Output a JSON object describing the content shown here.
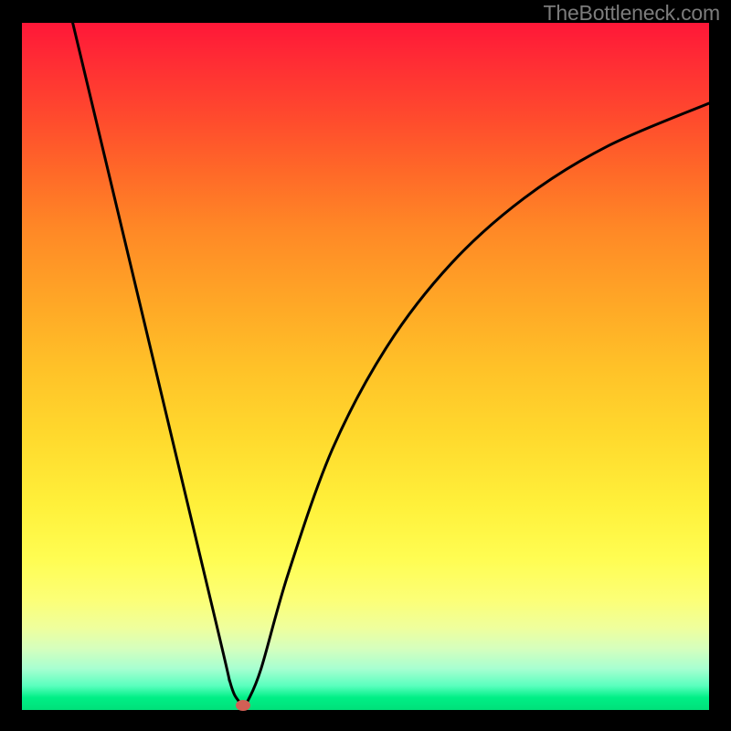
{
  "attribution": "TheBottleneck.com",
  "colors": {
    "dot": "#d16055",
    "curve": "#000000"
  },
  "chart_data": {
    "type": "line",
    "title": "",
    "xlabel": "",
    "ylabel": "",
    "xlim": [
      0,
      100
    ],
    "ylim": [
      0,
      100
    ],
    "series": [
      {
        "name": "bottleneck-curve",
        "points": [
          {
            "x": 7.4,
            "y": 100
          },
          {
            "x": 27.7,
            "y": 15
          },
          {
            "x": 30.3,
            "y": 4
          },
          {
            "x": 31.6,
            "y": 1.2
          },
          {
            "x": 32.2,
            "y": 0.6
          },
          {
            "x": 32.8,
            "y": 1.2
          },
          {
            "x": 34.8,
            "y": 6
          },
          {
            "x": 38.8,
            "y": 20
          },
          {
            "x": 45.2,
            "y": 38
          },
          {
            "x": 53.2,
            "y": 53
          },
          {
            "x": 62.5,
            "y": 65
          },
          {
            "x": 73.1,
            "y": 74.5
          },
          {
            "x": 85.1,
            "y": 82
          },
          {
            "x": 100,
            "y": 88.3
          }
        ]
      }
    ],
    "marker": {
      "x": 32.2,
      "y": 0.7
    }
  }
}
